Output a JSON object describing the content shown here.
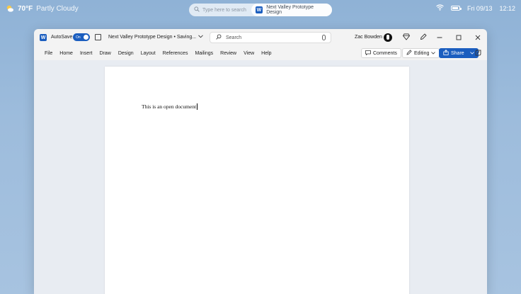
{
  "system": {
    "weather_temp": "70°F",
    "weather_condition": "Partly Cloudy",
    "search_placeholder": "Type here to search",
    "taskbar_app": "Next Valley Prototype Design",
    "date": "Fri 09/13",
    "time": "12:12"
  },
  "window": {
    "app_logo": "W",
    "autosave_label": "AutoSave",
    "toggle_label": "On",
    "document_title": "Next Valley Prototype Design • Saving...",
    "search_placeholder": "Search",
    "user_name": "Zac Bowden"
  },
  "menu": {
    "items": [
      "File",
      "Home",
      "Insert",
      "Draw",
      "Design",
      "Layout",
      "References",
      "Mailings",
      "Review",
      "View",
      "Help"
    ],
    "comments_label": "Comments",
    "editing_label": "Editing",
    "share_label": "Share"
  },
  "document": {
    "text": "This is an open document"
  },
  "colors": {
    "accent": "#1b5ebf"
  }
}
